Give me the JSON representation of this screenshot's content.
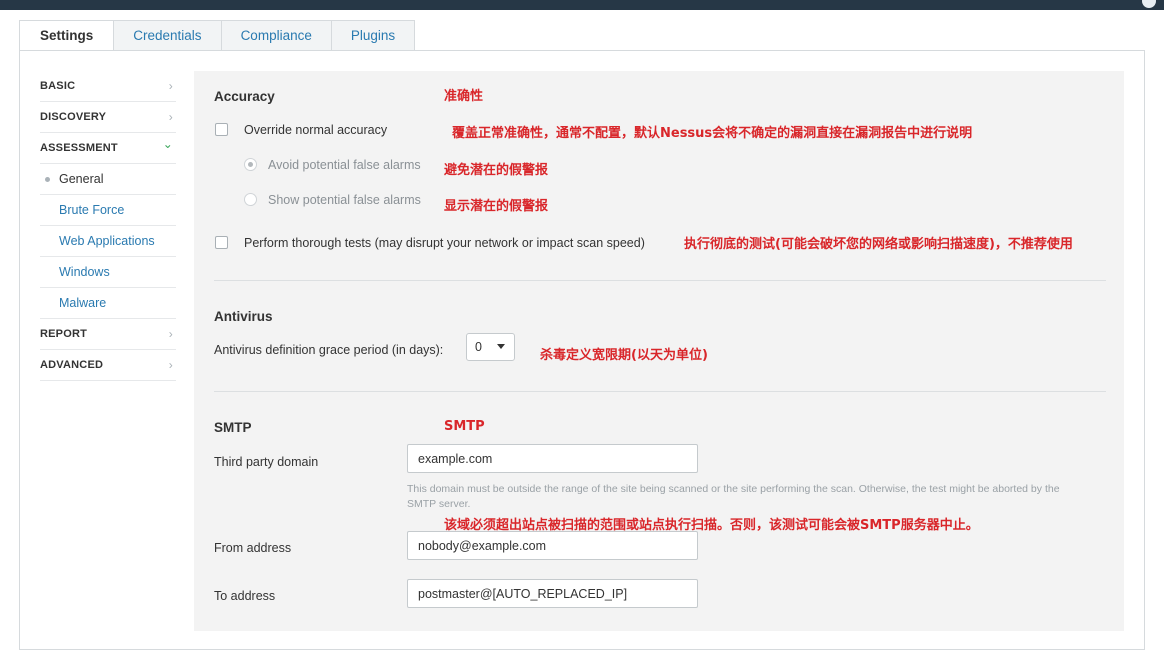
{
  "tabs": [
    "Settings",
    "Credentials",
    "Compliance",
    "Plugins"
  ],
  "sidebar": {
    "basic": "BASIC",
    "discovery": "DISCOVERY",
    "assessment": "ASSESSMENT",
    "sub": [
      "General",
      "Brute Force",
      "Web Applications",
      "Windows",
      "Malware"
    ],
    "report": "REPORT",
    "advanced": "ADVANCED",
    "chevron_right": "›",
    "chevron_down": "⌄"
  },
  "accuracy": {
    "title": "Accuracy",
    "override": "Override normal accuracy",
    "avoid": "Avoid potential false alarms",
    "show": "Show potential false alarms",
    "thorough": "Perform thorough tests (may disrupt your network or impact scan speed)"
  },
  "antivirus": {
    "title": "Antivirus",
    "grace_label": "Antivirus definition grace period (in days):",
    "grace_value": "0"
  },
  "smtp": {
    "title": "SMTP",
    "third_party_label": "Third party domain",
    "third_party_value": "example.com",
    "help": "This domain must be outside the range of the site being scanned or the site performing the scan. Otherwise, the test might be aborted by the SMTP server.",
    "from_label": "From address",
    "from_value": "nobody@example.com",
    "to_label": "To address",
    "to_value": "postmaster@[AUTO_REPLACED_IP]"
  },
  "annotations": {
    "accuracy": "准确性",
    "override": "覆盖正常准确性，通常不配置，默认Nessus会将不确定的漏洞直接在漏洞报告中进行说明",
    "avoid": "避免潜在的假警报",
    "show": "显示潜在的假警报",
    "thorough": "执行彻底的测试(可能会破坏您的网络或影响扫描速度)，不推荐使用",
    "antivirus": "杀毒定义宽限期(以天为单位)",
    "smtp": "SMTP",
    "domain": "该域必须超出站点被扫描的范围或站点执行扫描。否则，该测试可能会被SMTP服务器中止。"
  },
  "colors": {
    "annotation": "#d9262a",
    "link": "#2a7ab0",
    "topbar": "#263746"
  }
}
